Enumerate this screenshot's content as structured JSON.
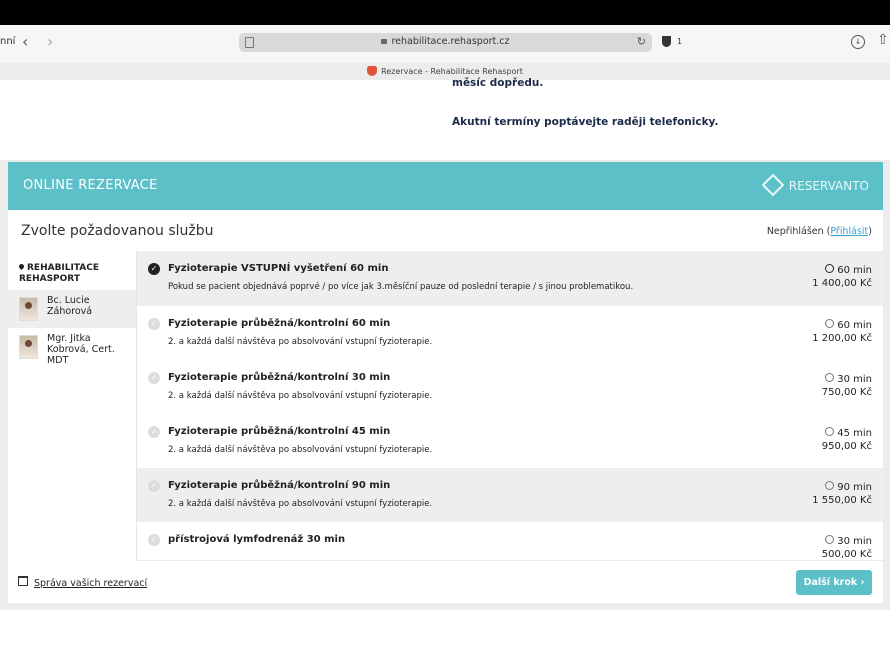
{
  "browser": {
    "back_label": "nní",
    "url": "rehabilitace.rehasport.cz",
    "shield_count": "1",
    "tab_title": "Rezervace - Rehabilitace Rehasport"
  },
  "page": {
    "notice_top": "měsíc dopředu.",
    "notice_phone": "Akutní termíny poptávejte raději telefonicky."
  },
  "widget": {
    "title": "ONLINE REZERVACE",
    "logo": "RESERVANTO",
    "subtitle": "Zvolte požadovanou službu",
    "login_prefix": "Nepřihlášen (",
    "login_link": "Přihlásit",
    "login_suffix": ")",
    "location": "REHABILITACE REHASPORT",
    "people": [
      {
        "name": "Bc. Lucie Záhorová"
      },
      {
        "name": "Mgr. Jitka Kobrová, Cert. MDT"
      }
    ],
    "services": [
      {
        "title": "Fyzioterapie VSTUPNÍ vyšetření 60 min",
        "desc": "Pokud se pacient objednává poprvé / po více jak 3.měsíční pauze od poslední terapie / s jinou problematikou.",
        "duration": "60 min",
        "price": "1 400,00 Kč"
      },
      {
        "title": "Fyzioterapie průběžná/kontrolní 60 min",
        "desc": "2. a každá další návštěva po absolvování vstupní fyzioterapie.",
        "duration": "60 min",
        "price": "1 200,00 Kč"
      },
      {
        "title": "Fyzioterapie průběžná/kontrolní 30 min",
        "desc": "2. a každá další návštěva po absolvování vstupní fyzioterapie.",
        "duration": "30 min",
        "price": "750,00 Kč"
      },
      {
        "title": "Fyzioterapie průběžná/kontrolní 45 min",
        "desc": "2. a každá další návštěva po absolvování vstupní fyzioterapie.",
        "duration": "45 min",
        "price": "950,00 Kč"
      },
      {
        "title": "Fyzioterapie průběžná/kontrolní 90 min",
        "desc": "2. a každá další návštěva po absolvování vstupní fyzioterapie.",
        "duration": "90 min",
        "price": "1 550,00 Kč"
      },
      {
        "title": "přístrojová lymfodrenáž 30 min",
        "desc": "",
        "duration": "30 min",
        "price": "500,00 Kč"
      }
    ],
    "manage_label": "Správa vašich rezervací",
    "next_label": "Další krok"
  },
  "colors": {
    "accent": "#5bc0c8",
    "text": "#222222",
    "notice": "#1b2a48"
  }
}
